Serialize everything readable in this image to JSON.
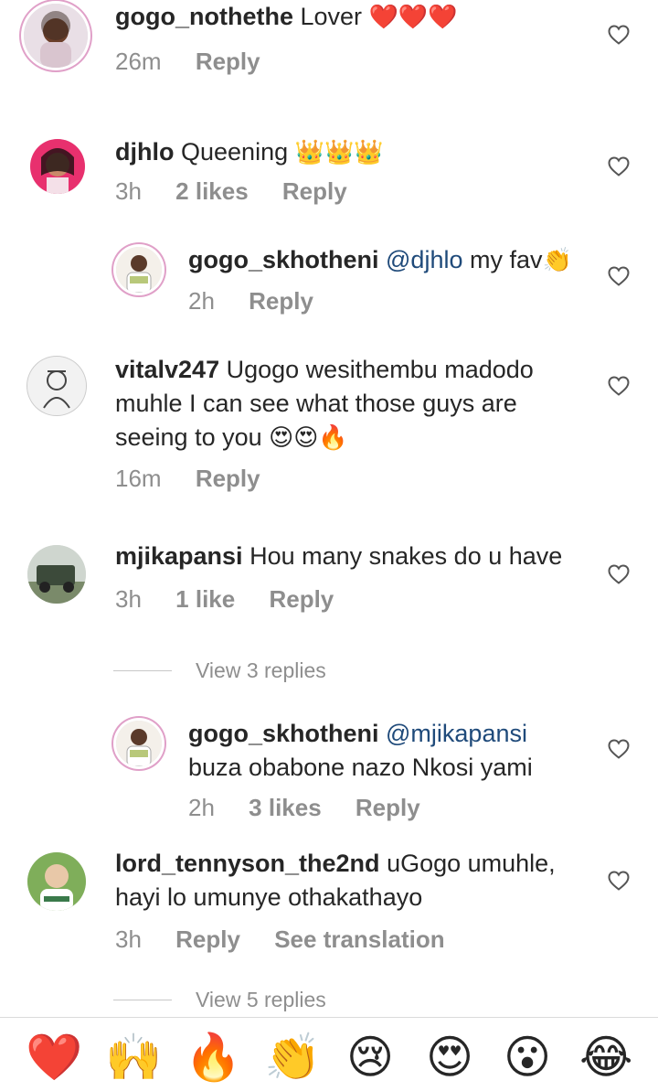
{
  "comments": [
    {
      "username": "gogo_nothethe",
      "text": "Lover",
      "emoji": "❤️❤️❤️",
      "time": "26m",
      "reply": "Reply"
    },
    {
      "username": "djhlo",
      "text": "Queening",
      "emoji": "👑👑👑",
      "time": "3h",
      "likes": "2 likes",
      "reply": "Reply"
    },
    {
      "username": "gogo_skhotheni",
      "mention": "@djhlo",
      "text": "my fav",
      "emoji": "👏",
      "time": "2h",
      "reply": "Reply"
    },
    {
      "username": "vitalv247",
      "text_line1": "Ugogo wesithembu madodo",
      "text_line2": "muhle I can see what those guys are",
      "text_line3": "seeing to you",
      "emoji": "😍😍🔥",
      "time": "16m",
      "reply": "Reply"
    },
    {
      "username": "mjikapansi",
      "text": "Hou many snakes do u have",
      "time": "3h",
      "likes": "1 like",
      "reply": "Reply"
    },
    {
      "username": "gogo_skhotheni",
      "mention": "@mjikapansi",
      "text_line2": "buza obabone nazo Nkosi yami",
      "time": "2h",
      "likes": "3 likes",
      "reply": "Reply"
    },
    {
      "username": "lord_tennyson_the2nd",
      "text": "uGogo umuhle,",
      "text_line2": "hayi lo umunye othakathayo",
      "time": "3h",
      "reply": "Reply",
      "translate": "See translation"
    }
  ],
  "view_replies_1": "View 3 replies",
  "view_replies_2": "View 5 replies",
  "emoji_bar": [
    "❤️",
    "🙌",
    "🔥",
    "👏",
    "😢",
    "😍",
    "😮",
    "😂"
  ],
  "colors": {
    "text": "#262626",
    "meta": "#8e8e8e",
    "mention": "#1f4a7a"
  }
}
